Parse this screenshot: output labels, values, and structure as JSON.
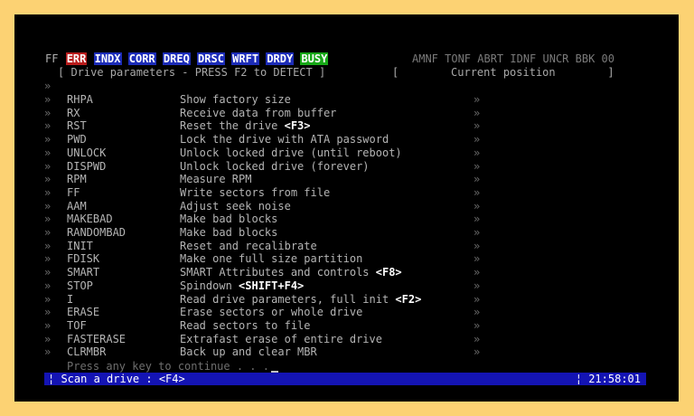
{
  "flags_left": [
    {
      "label": "FF",
      "style": "plain"
    },
    {
      "label": "ERR",
      "style": "red"
    },
    {
      "label": "INDX",
      "style": "blue"
    },
    {
      "label": "CORR",
      "style": "blue"
    },
    {
      "label": "DREQ",
      "style": "blue"
    },
    {
      "label": "DRSC",
      "style": "blue"
    },
    {
      "label": "WRFT",
      "style": "blue"
    },
    {
      "label": "DRDY",
      "style": "blue"
    },
    {
      "label": "BUSY",
      "style": "green"
    }
  ],
  "flags_right": "AMNF TONF ABRT IDNF UNCR BBK 00",
  "header": {
    "left": "[ Drive parameters - PRESS F2 to DETECT ]",
    "right": "[        Current position        ]"
  },
  "bullet": "»",
  "commands": [
    {
      "cmd": "RHPA",
      "desc": "Show factory size",
      "hotkey": ""
    },
    {
      "cmd": "RX",
      "desc": "Receive data from buffer",
      "hotkey": ""
    },
    {
      "cmd": "RST",
      "desc": "Reset the drive ",
      "hotkey": "<F3>"
    },
    {
      "cmd": "PWD",
      "desc": "Lock the drive with ATA password",
      "hotkey": ""
    },
    {
      "cmd": "UNLOCK",
      "desc": "Unlock locked drive (until reboot)",
      "hotkey": ""
    },
    {
      "cmd": "DISPWD",
      "desc": "Unlock locked drive (forever)",
      "hotkey": ""
    },
    {
      "cmd": "RPM",
      "desc": "Measure RPM",
      "hotkey": ""
    },
    {
      "cmd": "FF",
      "desc": "Write sectors from file",
      "hotkey": ""
    },
    {
      "cmd": "AAM",
      "desc": "Adjust seek noise",
      "hotkey": ""
    },
    {
      "cmd": "MAKEBAD",
      "desc": "Make bad blocks",
      "hotkey": ""
    },
    {
      "cmd": "RANDOMBAD",
      "desc": "Make bad blocks",
      "hotkey": ""
    },
    {
      "cmd": "INIT",
      "desc": "Reset and recalibrate",
      "hotkey": ""
    },
    {
      "cmd": "FDISK",
      "desc": "Make one full size partition",
      "hotkey": ""
    },
    {
      "cmd": "SMART",
      "desc": "SMART Attributes and controls ",
      "hotkey": "<F8>"
    },
    {
      "cmd": "STOP",
      "desc": "Spindown ",
      "hotkey": "<SHIFT+F4>"
    },
    {
      "cmd": "I",
      "desc": "Read drive parameters, full init ",
      "hotkey": "<F2>"
    },
    {
      "cmd": "ERASE",
      "desc": "Erase sectors or whole drive",
      "hotkey": ""
    },
    {
      "cmd": "TOF",
      "desc": "Read sectors to file",
      "hotkey": ""
    },
    {
      "cmd": "FASTERASE",
      "desc": "Extrafast erase of entire drive",
      "hotkey": ""
    },
    {
      "cmd": "CLRMBR",
      "desc": "Back up and clear MBR",
      "hotkey": ""
    }
  ],
  "prompt": "Press any key to continue . . .",
  "statusbar": {
    "left": "¦ Scan a drive : <F4>",
    "right": "¦ 21:58:01"
  }
}
